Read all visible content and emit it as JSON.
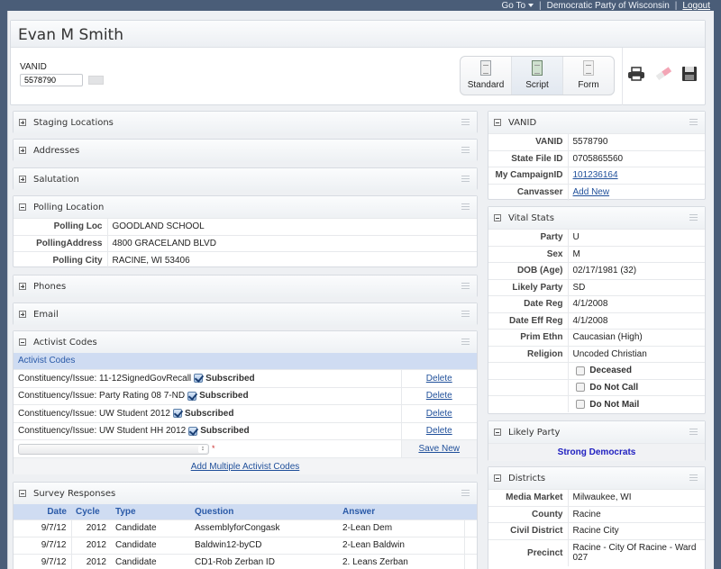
{
  "topbar": {
    "goto_label": "Go To",
    "organization": "Democratic Party of Wisconsin",
    "logout_label": "Logout",
    "separator": "|"
  },
  "header": {
    "title": "Evan M Smith",
    "vanid_label": "VANID",
    "vanid_value": "5578790",
    "view_buttons": [
      {
        "label": "Standard",
        "icon": "document-icon"
      },
      {
        "label": "Script",
        "icon": "script-icon"
      },
      {
        "label": "Form",
        "icon": "form-icon"
      }
    ],
    "tools": [
      "print-icon",
      "eraser-icon",
      "save-icon"
    ]
  },
  "left_panels": {
    "staging": {
      "title": "Staging Locations"
    },
    "addresses": {
      "title": "Addresses"
    },
    "salutation": {
      "title": "Salutation"
    },
    "polling": {
      "title": "Polling Location",
      "rows": [
        {
          "label": "Polling Loc",
          "value": "GOODLAND SCHOOL"
        },
        {
          "label": "PollingAddress",
          "value": "4800 GRACELAND BLVD"
        },
        {
          "label": "Polling City",
          "value": "RACINE, WI 53406"
        }
      ]
    },
    "phones": {
      "title": "Phones"
    },
    "email": {
      "title": "Email"
    },
    "activist": {
      "title": "Activist Codes",
      "subheader": "Activist Codes",
      "rows": [
        {
          "code": "Constituency/Issue: 11-12SignedGovRecall",
          "status": "Subscribed",
          "action": "Delete"
        },
        {
          "code": "Constituency/Issue: Party Rating 08 7-ND",
          "status": "Subscribed",
          "action": "Delete"
        },
        {
          "code": "Constituency/Issue: UW Student 2012",
          "status": "Subscribed",
          "action": "Delete"
        },
        {
          "code": "Constituency/Issue: UW Student HH 2012",
          "status": "Subscribed",
          "action": "Delete"
        }
      ],
      "select_value": "",
      "required_mark": "*",
      "save_new": "Save New",
      "add_multiple": "Add Multiple Activist Codes"
    },
    "survey": {
      "title": "Survey Responses",
      "columns": [
        "Date",
        "Cycle",
        "Type",
        "Question",
        "Answer"
      ],
      "rows": [
        {
          "date": "9/7/12",
          "cycle": "2012",
          "type": "Candidate",
          "question": "AssemblyforCongask",
          "answer": "2-Lean Dem"
        },
        {
          "date": "9/7/12",
          "cycle": "2012",
          "type": "Candidate",
          "question": "Baldwin12-byCD",
          "answer": "2-Lean Baldwin"
        },
        {
          "date": "9/7/12",
          "cycle": "2012",
          "type": "Candidate",
          "question": "CD1-Rob Zerban ID",
          "answer": "2. Leans Zerban"
        }
      ]
    }
  },
  "right_panels": {
    "vanid": {
      "title": "VANID",
      "rows": [
        {
          "label": "VANID",
          "value": "5578790"
        },
        {
          "label": "State File ID",
          "value": "0705865560"
        },
        {
          "label": "My CampaignID",
          "value": "101236164",
          "link": true
        },
        {
          "label": "Canvasser",
          "value": "Add New",
          "link": true
        }
      ]
    },
    "vital": {
      "title": "Vital Stats",
      "rows": [
        {
          "label": "Party",
          "value": "U"
        },
        {
          "label": "Sex",
          "value": "M"
        },
        {
          "label": "DOB (Age)",
          "value": "02/17/1981 (32)"
        },
        {
          "label": "Likely Party",
          "value": "SD"
        },
        {
          "label": "Date Reg",
          "value": "4/1/2008"
        },
        {
          "label": "Date Eff Reg",
          "value": "4/1/2008"
        },
        {
          "label": "Prim Ethn",
          "value": "Caucasian (High)"
        },
        {
          "label": "Religion",
          "value": "Uncoded Christian"
        }
      ],
      "flags": [
        {
          "label": "Deceased",
          "checked": false
        },
        {
          "label": "Do Not Call",
          "checked": false
        },
        {
          "label": "Do Not Mail",
          "checked": false
        }
      ]
    },
    "likely_party": {
      "title": "Likely Party",
      "value": "Strong Democrats",
      "value_color": "#2020c0"
    },
    "districts": {
      "title": "Districts",
      "rows": [
        {
          "label": "Media Market",
          "value": "Milwaukee, WI"
        },
        {
          "label": "County",
          "value": "Racine"
        },
        {
          "label": "Civil District",
          "value": "Racine City"
        },
        {
          "label": "Precinct",
          "value": "Racine - City Of Racine - Ward 027"
        }
      ]
    }
  }
}
